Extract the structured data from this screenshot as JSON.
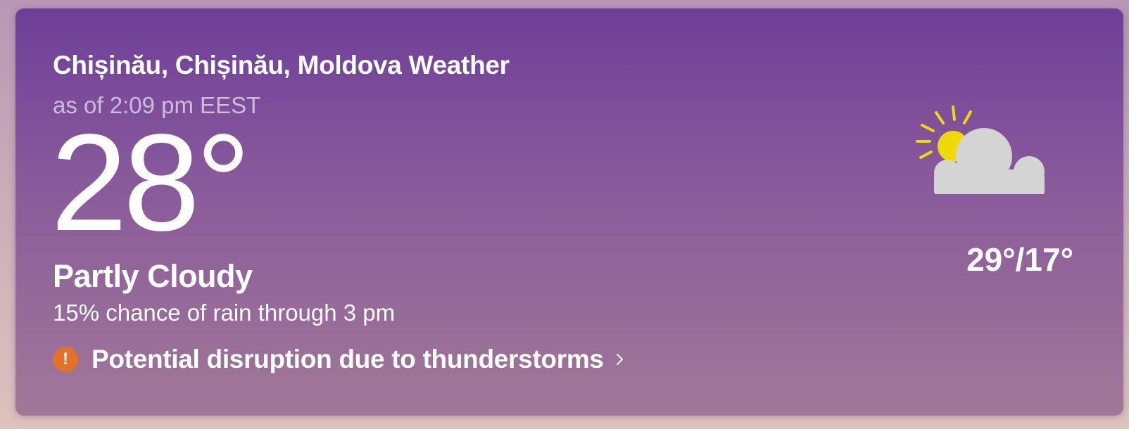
{
  "location_title": "Chișinău, Chișinău, Moldova Weather",
  "as_of": "as of 2:09 pm EEST",
  "current_temp": "28°",
  "condition": "Partly Cloudy",
  "rain_chance": "15% chance of rain through 3 pm",
  "alert": {
    "icon": "exclamation-icon",
    "symbol": "!",
    "text": "Potential disruption due to thunderstorms"
  },
  "weather_icon": "partly-cloudy-icon",
  "high_low": "29°/17°",
  "colors": {
    "card_top": "#6e3f98",
    "card_bottom": "#a17897",
    "alert_badge": "#e4712b",
    "sun": "#efd80b",
    "cloud": "#d4d4d4"
  }
}
